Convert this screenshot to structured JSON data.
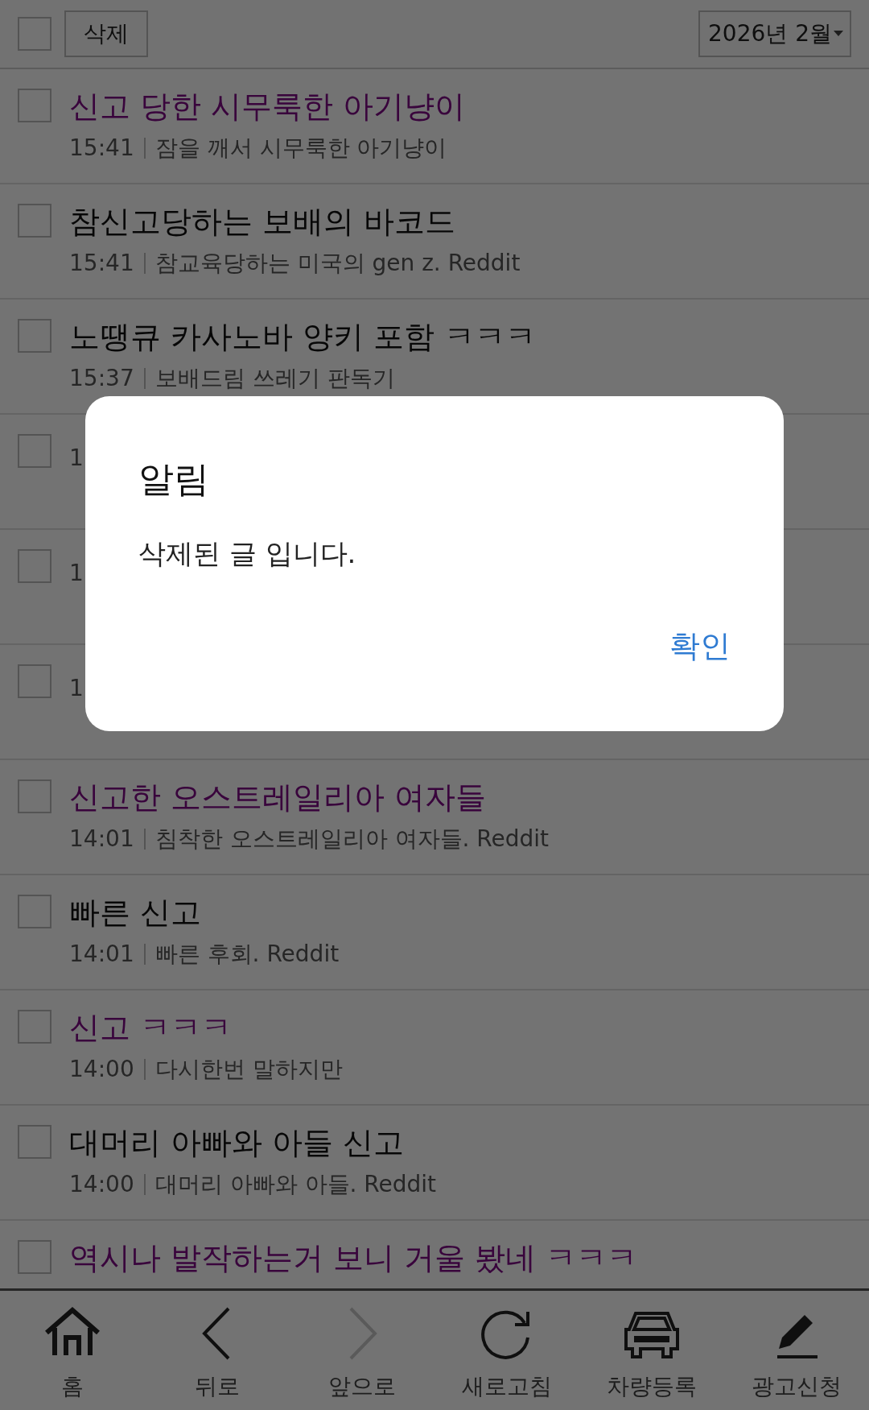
{
  "toolbar": {
    "select_all_checked": false,
    "delete_button": "삭제",
    "month_select": "2026년 2월"
  },
  "posts": [
    {
      "title": "신고 당한 시무룩한 아기냥이",
      "visited": true,
      "time": "15:41",
      "summary": "잠을 깨서 시무룩한 아기냥이",
      "checked": false
    },
    {
      "title": "참신고당하는 보배의 바코드",
      "visited": false,
      "time": "15:41",
      "summary": "참교육당하는 미국의 gen z. Reddit",
      "checked": false
    },
    {
      "title": "노땡큐 카사노바 양키 포함 ㅋㅋㅋ",
      "visited": false,
      "time": "15:37",
      "summary": "보배드림 쓰레기 판독기",
      "checked": false
    },
    {
      "time": "1",
      "checked": false
    },
    {
      "time": "1",
      "checked": false
    },
    {
      "time": "1",
      "checked": false
    },
    {
      "title": "신고한 오스트레일리아 여자들",
      "visited": true,
      "time": "14:01",
      "summary": "침착한 오스트레일리아 여자들. Reddit",
      "checked": false
    },
    {
      "title": "빠른 신고",
      "visited": false,
      "time": "14:01",
      "summary": "빠른 후회. Reddit",
      "checked": false
    },
    {
      "title": "신고 ㅋㅋㅋ",
      "visited": true,
      "time": "14:00",
      "summary": "다시한번 말하지만",
      "checked": false
    },
    {
      "title": "대머리 아빠와 아들 신고",
      "visited": false,
      "time": "14:00",
      "summary": "대머리 아빠와 아들. Reddit",
      "checked": false
    },
    {
      "title": "역시나 발작하는거 보니 거울 봤네 ㅋㅋㅋ",
      "visited": true,
      "checked": false
    }
  ],
  "bottom_nav": [
    {
      "kind": "home",
      "label": "홈",
      "disabled": false
    },
    {
      "kind": "back",
      "label": "뒤로",
      "disabled": false
    },
    {
      "kind": "forward",
      "label": "앞으로",
      "disabled": true
    },
    {
      "kind": "refresh",
      "label": "새로고침",
      "disabled": false
    },
    {
      "kind": "car",
      "label": "차량등록",
      "disabled": false
    },
    {
      "kind": "pen",
      "label": "광고신청",
      "disabled": false
    }
  ],
  "dialog": {
    "title": "알림",
    "message": "삭제된 글 입니다.",
    "confirm_button": "확인"
  }
}
